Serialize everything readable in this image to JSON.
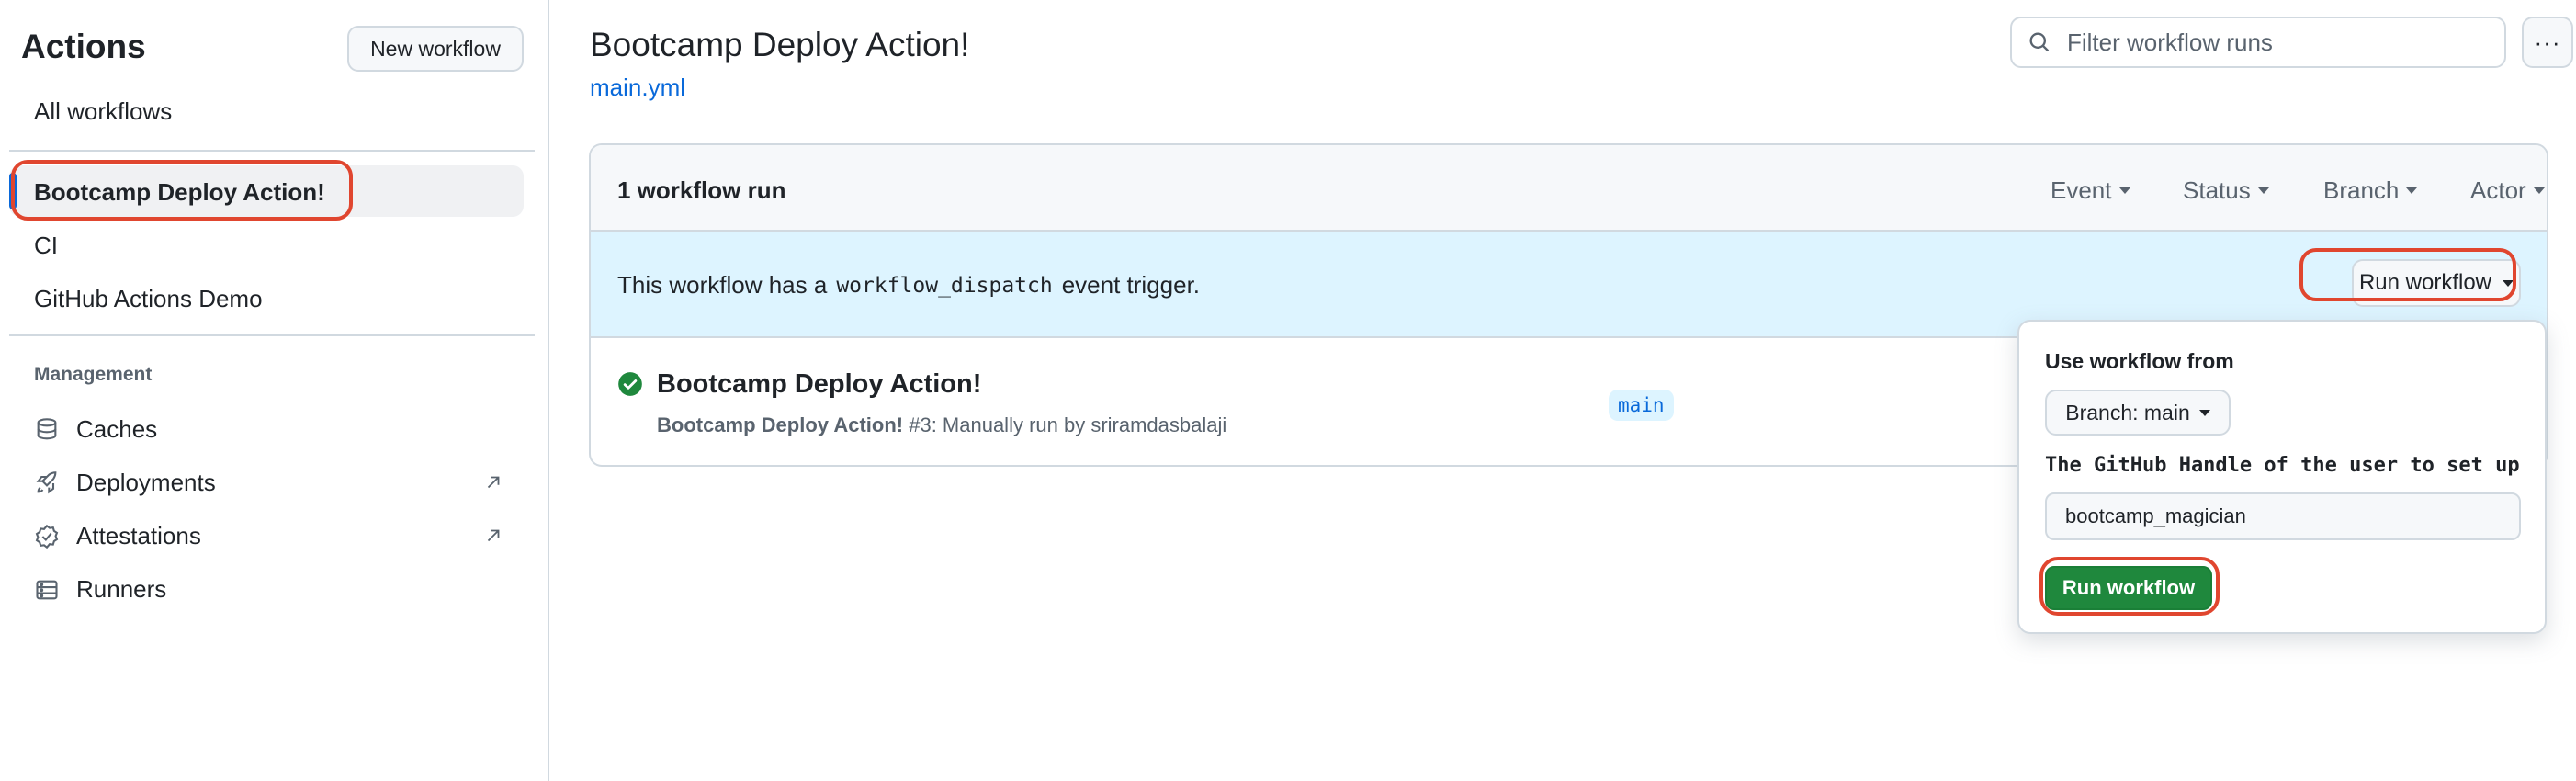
{
  "sidebar": {
    "title": "Actions",
    "new_workflow_label": "New workflow",
    "all_workflows": "All workflows",
    "workflows": [
      "Bootcamp Deploy Action!",
      "CI",
      "GitHub Actions Demo"
    ],
    "management_title": "Management",
    "management_items": [
      {
        "label": "Caches",
        "icon": "database-icon",
        "external": false
      },
      {
        "label": "Deployments",
        "icon": "rocket-icon",
        "external": true
      },
      {
        "label": "Attestations",
        "icon": "verified-icon",
        "external": true
      },
      {
        "label": "Runners",
        "icon": "server-icon",
        "external": false
      }
    ]
  },
  "header": {
    "title": "Bootcamp Deploy Action!",
    "file_link": "main.yml",
    "filter_placeholder": "Filter workflow runs",
    "more_label": "···"
  },
  "runs": {
    "count_label": "1 workflow run",
    "filters": [
      "Event",
      "Status",
      "Branch",
      "Actor"
    ],
    "dispatch_prefix": "This workflow has a",
    "dispatch_code": "workflow_dispatch",
    "dispatch_suffix": "event trigger.",
    "run_workflow_label": "Run workflow",
    "items": [
      {
        "title": "Bootcamp Deploy Action!",
        "workflow_name": "Bootcamp Deploy Action!",
        "run_detail": "#3: Manually run by sriramdasbalaji",
        "branch": "main",
        "status": "success"
      }
    ]
  },
  "popover": {
    "use_from_label": "Use workflow from",
    "branch_label": "Branch: main",
    "input_label": "The GitHub Handle of the user to set up",
    "input_value": "bootcamp_magician",
    "submit_label": "Run workflow"
  },
  "colors": {
    "accent": "#0969da",
    "success": "#1f883d",
    "highlight": "#e0462f",
    "info_bg": "#ddf4ff"
  }
}
